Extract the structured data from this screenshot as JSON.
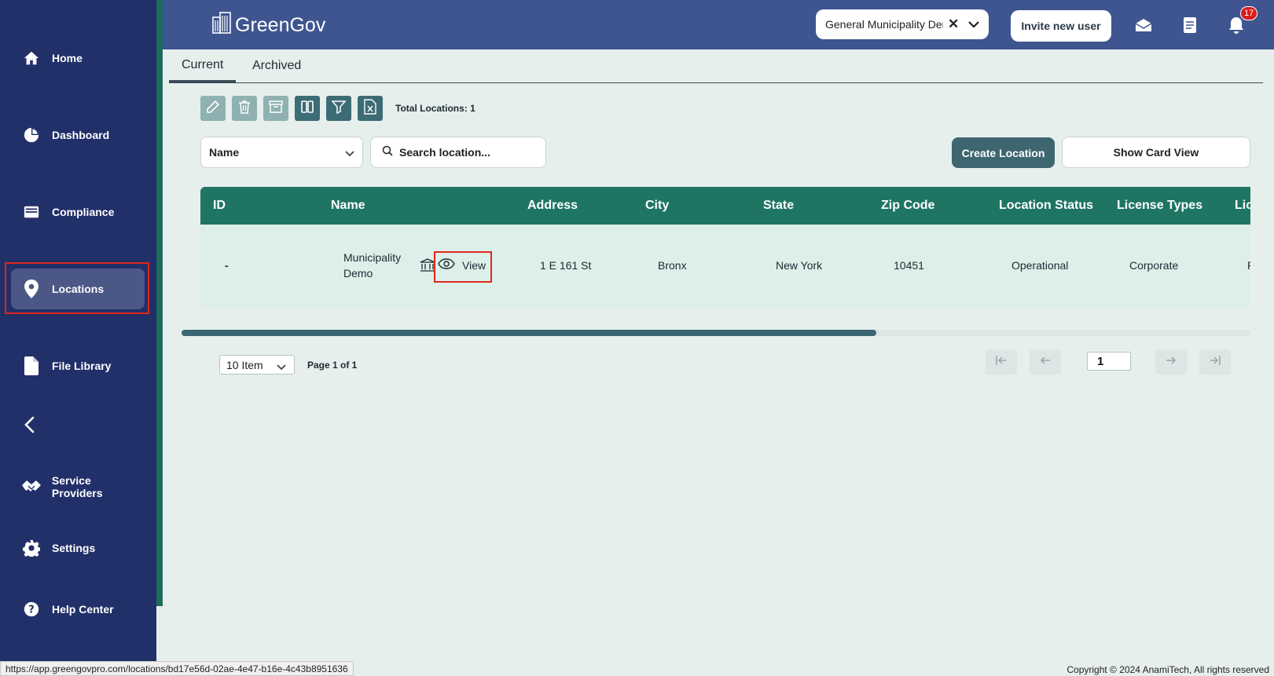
{
  "sidebar": {
    "items": [
      {
        "label": "Home",
        "icon": "home-icon"
      },
      {
        "label": "Dashboard",
        "icon": "pie-chart-icon"
      },
      {
        "label": "Compliance",
        "icon": "inbox-icon"
      },
      {
        "label": "Locations",
        "icon": "map-pin-icon",
        "active": true
      },
      {
        "label": "File Library",
        "icon": "file-icon"
      },
      {
        "label": "Service Providers",
        "icon": "handshake-icon"
      },
      {
        "label": "Settings",
        "icon": "gear-icon"
      },
      {
        "label": "Help Center",
        "icon": "help-icon"
      }
    ],
    "collapse_icon": "chevron-left-icon"
  },
  "header": {
    "brand": "GreenGov",
    "org_select": {
      "value": "General Municipality Dem",
      "clear": "✕"
    },
    "invite_label": "Invite new user",
    "notification_count": "17"
  },
  "tabs": [
    {
      "label": "Current",
      "active": true
    },
    {
      "label": "Archived",
      "active": false
    }
  ],
  "toolbar": {
    "total_label": "Total Locations: 1"
  },
  "filters": {
    "field_select": "Name",
    "search_placeholder": "Search location...",
    "create_label": "Create Location",
    "card_view_label": "Show Card View"
  },
  "table": {
    "columns": [
      "ID",
      "Name",
      "Address",
      "City",
      "State",
      "Zip Code",
      "Location Status",
      "License Types",
      "Lic"
    ],
    "rows": [
      {
        "id": "-",
        "name_line1": "Municipality",
        "name_line2": "Demo",
        "view_label": "View",
        "address": "1 E 161 St",
        "city": "Bronx",
        "state": "New York",
        "zip": "10451",
        "status": "Operational",
        "license_type": "Corporate",
        "lic": "F"
      }
    ],
    "scroll_fraction": 0.65
  },
  "pagination": {
    "per_page": "10 Item",
    "page_info": "Page 1 of 1",
    "current_page": "1"
  },
  "status_bar_url": "https://app.greengovpro.com/locations/bd17e56d-02ae-4e47-b16e-4c43b8951636",
  "copyright": "Copyright © 2024 AnamiTech, All rights reserved",
  "colors": {
    "sidebar": "#22306a",
    "header": "#3f5590",
    "table_header": "#1f7564",
    "primary_button": "#3d6670",
    "highlight": "#e0261b"
  }
}
